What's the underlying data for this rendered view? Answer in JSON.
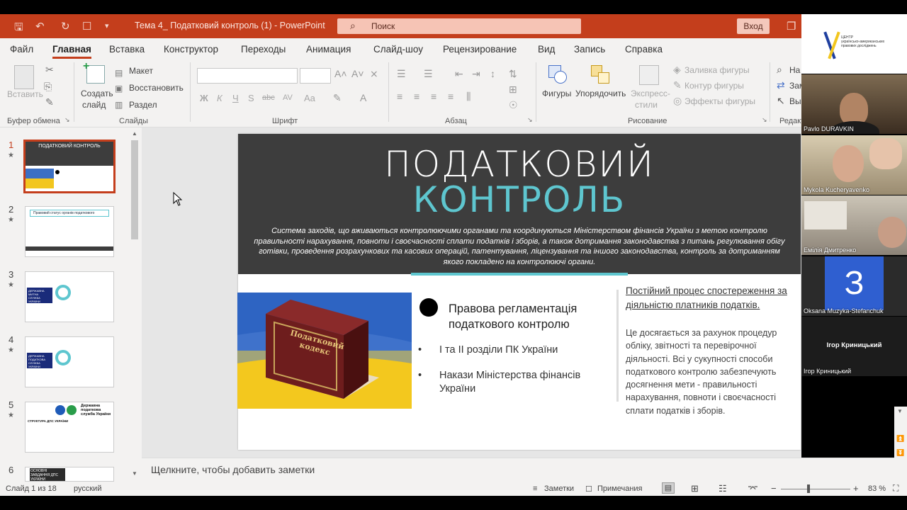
{
  "app": {
    "window_title": "Тема 4_ Податковий контроль (1)  -  PowerPoint",
    "search_placeholder": "Поиск",
    "signin_label": "Вход"
  },
  "menu": {
    "items": [
      "Файл",
      "Главная",
      "Вставка",
      "Конструктор",
      "Переходы",
      "Анимация",
      "Слайд-шоу",
      "Рецензирование",
      "Вид",
      "Запись",
      "Справка"
    ],
    "active": "Главная"
  },
  "ribbon": {
    "clipboard": {
      "paste": "Вставить",
      "group": "Буфер обмена"
    },
    "slides": {
      "new_slide_line1": "Создать",
      "new_slide_line2": "слайд",
      "layout": "Макет",
      "reset": "Восстановить",
      "section": "Раздел",
      "group": "Слайды"
    },
    "font": {
      "group": "Шрифт",
      "bold": "Ж",
      "italic": "К",
      "underline": "Ч",
      "shadow": "S",
      "strike": "abc",
      "case": "Aa"
    },
    "paragraph": {
      "group": "Абзац"
    },
    "drawing": {
      "shapes": "Фигуры",
      "arrange": "Упорядочить",
      "quick_styles_line1": "Экспресс-",
      "quick_styles_line2": "стили",
      "fill": "Заливка фигуры",
      "outline": "Контур фигуры",
      "effects": "Эффекты фигуры",
      "group": "Рисование"
    },
    "editing": {
      "find": "На",
      "replace": "Зам",
      "select": "Вы",
      "group": "Редакт"
    }
  },
  "thumbnails": [
    {
      "num": "1",
      "caption": "ПОДАТКОВИЙ КОНТРОЛЬ"
    },
    {
      "num": "2",
      "caption": "Правовий статус органів податкового контролю"
    },
    {
      "num": "3",
      "caption": "ДЕРЖАВНА МИТНА СЛУЖБА УКРАЇНИ"
    },
    {
      "num": "4",
      "caption": "ДЕРЖАВНА ПОДАТКОВА СЛУЖБА УКРАЇНИ"
    },
    {
      "num": "5",
      "caption": "Державна податкова служба України",
      "sub": "СТРУКТУРА ДПС УКРАЇНИ"
    },
    {
      "num": "6",
      "caption": "ОСНОВНІ ЗАВДАННЯ ДПС УКРАЇНИ"
    }
  ],
  "slide": {
    "title_line1": "ПОДАТКОВИЙ",
    "title_line2": "КОНТРОЛЬ",
    "subtitle": "Система заходів, що вживаються контролюючими органами та координуються Міністерством фінансів України з метою контролю правильності нарахування, повноти і своєчасності сплати податків і зборів, а також дотримання законодавства з питань регулювання обігу готівки, проведення розрахункових та касових операцій, патентування, ліцензування та іншого законодавства, контроль за дотриманням якого покладено на контролюючі органи.",
    "book_title": "Податковий кодекс",
    "heading": "Правова регламентація податкового контролю",
    "bullets": [
      "І та ІІ розділи ПК України",
      "Накази Міністерства фінансів України"
    ],
    "right_heading": "Постійний процес спостереження за діяльністю платників податків.",
    "right_body": "Це досягається за рахунок процедур обліку, звітності та перевірочної діяльності. Всі у сукупності способи податкового контролю забезпечують досягнення мети - правильності нарахування, повноти і своєчасності сплати податків і зборів."
  },
  "notes_placeholder": "Щелкните, чтобы добавить заметки",
  "status": {
    "slide_info": "Слайд 1 из 18",
    "language": "русский",
    "notes": "Заметки",
    "comments": "Примечания",
    "zoom": "83 %"
  },
  "participants": [
    {
      "name": "Pavlo DURAVKIN"
    },
    {
      "name": "Mykola Kucheryavenko"
    },
    {
      "name": "Емілія Дмитренко"
    },
    {
      "name": "Oksana Muzyka-Stefanchuk",
      "initial": "З"
    },
    {
      "name": "Ігор Криницький"
    }
  ],
  "logo": {
    "text_line1": "ЦЕНТР",
    "text_line2": "українсько-американських",
    "text_line3": "правових досліджень"
  },
  "colors": {
    "accent": "#c43e1c",
    "teal": "#5ec6cf",
    "slide_dark": "#3d3d3d",
    "avatar_blue": "#2f5fd0"
  }
}
